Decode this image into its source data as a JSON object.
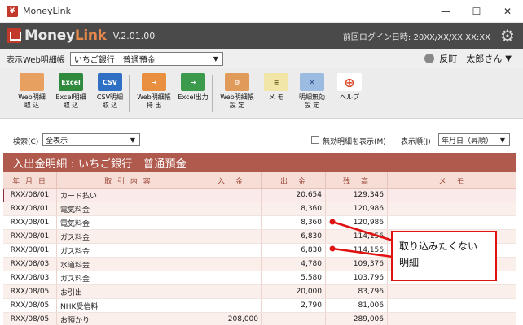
{
  "window": {
    "title": "MoneyLink",
    "minimize": "—",
    "maximize": "☐",
    "close": "✕"
  },
  "appbar": {
    "logo_money": "Money",
    "logo_link": "Link",
    "version": "V.2.01.00",
    "last_login": "前回ログイン日時: 20XX/XX/XX XX:XX"
  },
  "account_row": {
    "label": "表示Web明細帳",
    "selected_account": "いちご銀行　普通預金",
    "user_name": "反町　太郎さん",
    "user_caret": "▼"
  },
  "toolbar": {
    "buttons": [
      {
        "label": "Web明細\n取 込",
        "icon": "web-statement-icon"
      },
      {
        "label": "Excel明細\n取 込",
        "icon": "excel-icon",
        "icon_text": "Excel"
      },
      {
        "label": "CSV明細\n取 込",
        "icon": "csv-icon",
        "icon_text": "CSV"
      },
      {
        "label": "Web明細帳\n持 出",
        "icon": "export-icon"
      },
      {
        "label": "Excel出力",
        "icon": "excel-output-icon"
      },
      {
        "label": "Web明細帳\n設 定",
        "icon": "settings-icon"
      },
      {
        "label": "メ モ",
        "icon": "memo-icon"
      },
      {
        "label": "明細無効\n設 定",
        "icon": "invalidate-icon"
      },
      {
        "label": "ヘルプ",
        "icon": "help-icon"
      }
    ]
  },
  "filter": {
    "search_label": "検索(C)",
    "search_value": "全表示",
    "show_invalid_label": "無効明細を表示(M)",
    "sort_label": "表示順(J)",
    "sort_value": "年月日（昇順）"
  },
  "section_title": "入出金明細 : いちご銀行　普通預金",
  "table": {
    "headers": [
      "年 月 日",
      "取 引 内 容",
      "入　金",
      "出　金",
      "残　高",
      "メ　モ"
    ],
    "rows": [
      {
        "date": "RXX/08/01",
        "desc": "カード払い",
        "deposit": "",
        "withdrawal": "20,654",
        "balance": "129,346",
        "memo": ""
      },
      {
        "date": "RXX/08/01",
        "desc": "電気料金",
        "deposit": "",
        "withdrawal": "8,360",
        "balance": "120,986",
        "memo": ""
      },
      {
        "date": "RXX/08/01",
        "desc": "電気料金",
        "deposit": "",
        "withdrawal": "8,360",
        "balance": "120,986",
        "memo": ""
      },
      {
        "date": "RXX/08/01",
        "desc": "ガス料金",
        "deposit": "",
        "withdrawal": "6,830",
        "balance": "114,156",
        "memo": ""
      },
      {
        "date": "RXX/08/01",
        "desc": "ガス料金",
        "deposit": "",
        "withdrawal": "6,830",
        "balance": "114,156",
        "memo": ""
      },
      {
        "date": "RXX/08/03",
        "desc": "水道料金",
        "deposit": "",
        "withdrawal": "4,780",
        "balance": "109,376",
        "memo": ""
      },
      {
        "date": "RXX/08/03",
        "desc": "ガス料金",
        "deposit": "",
        "withdrawal": "5,580",
        "balance": "103,796",
        "memo": ""
      },
      {
        "date": "RXX/08/05",
        "desc": "お引出",
        "deposit": "",
        "withdrawal": "20,000",
        "balance": "83,796",
        "memo": ""
      },
      {
        "date": "RXX/08/05",
        "desc": "NHK受信料",
        "deposit": "",
        "withdrawal": "2,790",
        "balance": "81,006",
        "memo": ""
      },
      {
        "date": "RXX/08/05",
        "desc": "お預かり",
        "deposit": "208,000",
        "withdrawal": "",
        "balance": "289,006",
        "memo": ""
      }
    ]
  },
  "callout": {
    "line1": "取り込みたくない",
    "line2": "明細",
    "color": "#e01212"
  },
  "colors": {
    "appbar": "#4a4a4a",
    "section_header": "#b05a4d",
    "table_header_bg": "#f6ddd6",
    "selected_row_border": "#8f2e3b"
  }
}
